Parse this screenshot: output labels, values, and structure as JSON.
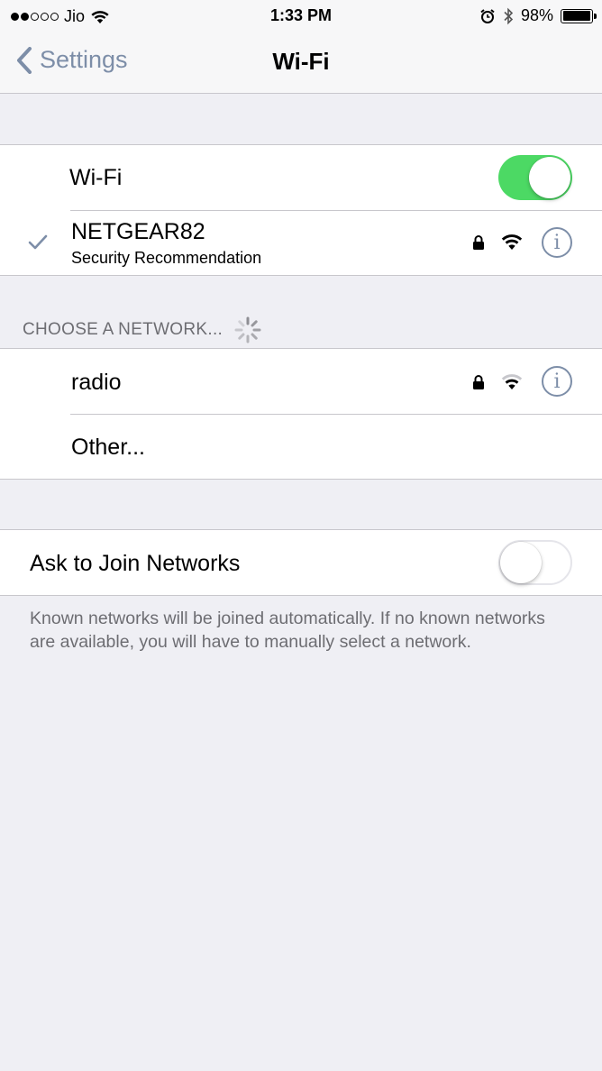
{
  "status_bar": {
    "carrier": "Jio",
    "time": "1:33 PM",
    "battery": "98%",
    "signal_bars_filled": 2,
    "signal_bars_total": 5,
    "battery_level": 0.98
  },
  "nav": {
    "back_label": "Settings",
    "title": "Wi-Fi"
  },
  "wifi": {
    "label": "Wi-Fi",
    "enabled": true
  },
  "connected": {
    "name": "NETGEAR82",
    "subtitle": "Security Recommendation",
    "secured": true
  },
  "choose_header": "CHOOSE A NETWORK...",
  "networks": [
    {
      "name": "radio",
      "secured": true
    },
    {
      "name": "Other..."
    }
  ],
  "ask_to_join": {
    "label": "Ask to Join Networks",
    "enabled": false,
    "footer": "Known networks will be joined automatically. If no known networks are available, you will have to manually select a network."
  },
  "colors": {
    "accent": "#7d8ea8",
    "toggle_on": "#4cd964",
    "background": "#efeff4",
    "secondary_text": "#6d6d72"
  }
}
